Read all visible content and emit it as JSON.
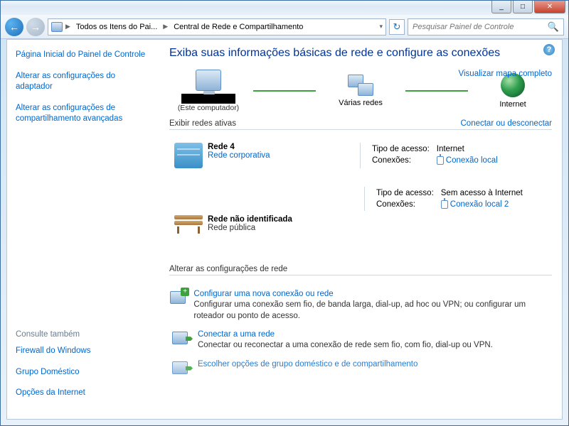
{
  "window": {
    "min": "_",
    "max": "□",
    "close": "✕"
  },
  "nav": {
    "back": "←",
    "fwd": "→",
    "refresh": "↻",
    "breadcrumb": [
      "Todos os Itens do Pai...",
      "Central de Rede e Compartilhamento"
    ],
    "search_placeholder": "Pesquisar Painel de Controle"
  },
  "sidebar": {
    "items": [
      "Página Inicial do Painel de Controle",
      "Alterar as configurações do adaptador",
      "Alterar as configurações de compartilhamento avançadas"
    ],
    "footer_head": "Consulte também",
    "footer_items": [
      "Firewall do Windows",
      "Grupo Doméstico",
      "Opções da Internet"
    ]
  },
  "main": {
    "help": "?",
    "title": "Exiba suas informações básicas de rede e configure as conexões",
    "map": {
      "node1_sub": "(Este computador)",
      "node2": "Várias redes",
      "node3": "Internet",
      "full_map": "Visualizar mapa completo"
    },
    "active_head": "Exibir redes ativas",
    "active_action": "Conectar ou desconectar",
    "networks": [
      {
        "name": "Rede  4",
        "type": "Rede corporativa",
        "type_link": true,
        "access_label": "Tipo de acesso:",
        "access_value": "Internet",
        "conn_label": "Conexões:",
        "conn_value": "Conexão local"
      },
      {
        "name": "Rede não identificada",
        "type": "Rede pública",
        "type_link": false,
        "access_label": "Tipo de acesso:",
        "access_value": "Sem acesso à Internet",
        "conn_label": "Conexões:",
        "conn_value": "Conexão local 2"
      }
    ],
    "settings_head": "Alterar as configurações de rede",
    "settings": [
      {
        "title": "Configurar uma nova conexão ou rede",
        "desc": "Configurar uma conexão sem fio, de banda larga, dial-up, ad hoc ou VPN; ou configurar um roteador ou ponto de acesso."
      },
      {
        "title": "Conectar a uma rede",
        "desc": "Conectar ou reconectar a uma conexão de rede sem fio, com fio, dial-up ou VPN."
      },
      {
        "title": "Escolher opções de grupo doméstico e de compartilhamento",
        "desc": ""
      }
    ]
  }
}
